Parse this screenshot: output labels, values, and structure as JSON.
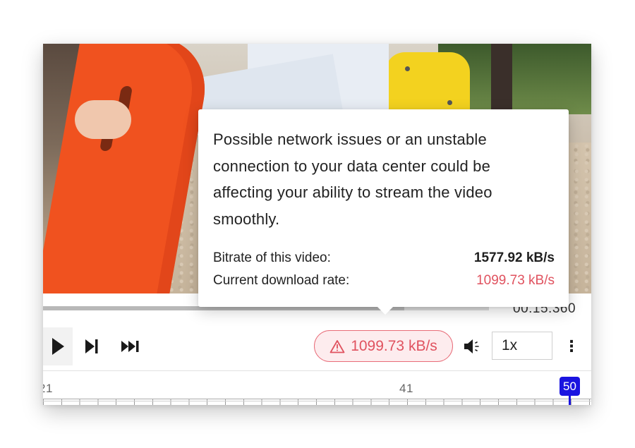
{
  "player": {
    "time_display": "00:15.360",
    "progress": {
      "played_fraction": 0.0,
      "buffered_fraction": 0.81
    },
    "rate_badge": {
      "icon": "warning-triangle-icon",
      "text": "1099.73 kB/s"
    },
    "playback_speed": "1x",
    "more_icon": "⋮"
  },
  "timeline": {
    "labels": [
      "21",
      "41"
    ],
    "marker": "50"
  },
  "tooltip": {
    "message": "Possible network issues or an unstable connection to your data center could be affecting your ability to stream the video smoothly.",
    "bitrate_label": "Bitrate of this video:",
    "bitrate_value": "1577.92 kB/s",
    "download_label": "Current download rate:",
    "download_value": "1099.73 kB/s"
  },
  "colors": {
    "warning": "#e0525f",
    "warning_bg": "#fdecee",
    "marker": "#1a14e0"
  }
}
